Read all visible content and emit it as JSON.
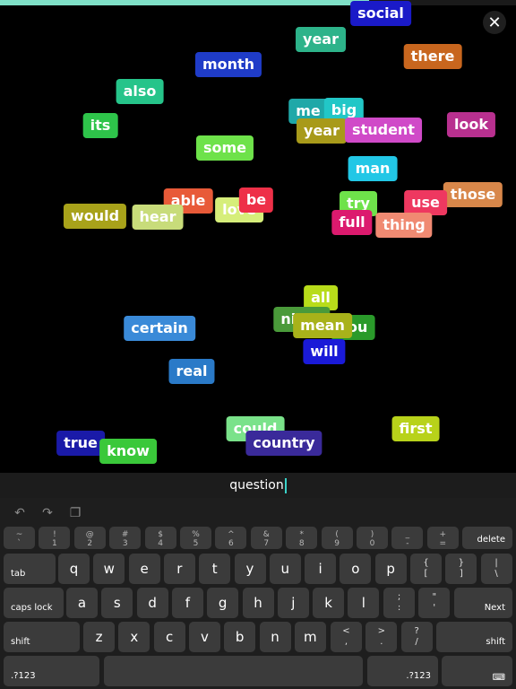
{
  "game": {
    "progress": 0.715,
    "close_symbol": "✕",
    "accent_color": "#7fe0c7",
    "words": [
      {
        "text": "social",
        "color": "#1a1ac8"
      },
      {
        "text": "year",
        "color": "#2db38a"
      },
      {
        "text": "there",
        "color": "#c8661e"
      },
      {
        "text": "month",
        "color": "#1f3cc8"
      },
      {
        "text": "also",
        "color": "#26c48a"
      },
      {
        "text": "me",
        "color": "#1fa8a8"
      },
      {
        "text": "big",
        "color": "#22c7c7"
      },
      {
        "text": "look",
        "color": "#b8308f"
      },
      {
        "text": "its",
        "color": "#2ec44a"
      },
      {
        "text": "year",
        "color": "#a89a1a"
      },
      {
        "text": "student",
        "color": "#d04ac8"
      },
      {
        "text": "some",
        "color": "#6ee24a"
      },
      {
        "text": "man",
        "color": "#22c7e6"
      },
      {
        "text": "those",
        "color": "#d8874a"
      },
      {
        "text": "able",
        "color": "#e85a38"
      },
      {
        "text": "would",
        "color": "#a8a21a"
      },
      {
        "text": "hear",
        "color": "#c8dc7a"
      },
      {
        "text": "love",
        "color": "#d6ee7a"
      },
      {
        "text": "be",
        "color": "#ee3048"
      },
      {
        "text": "try",
        "color": "#6ee24a"
      },
      {
        "text": "full",
        "color": "#dc1a6e"
      },
      {
        "text": "use",
        "color": "#ee3860"
      },
      {
        "text": "thing",
        "color": "#f08a72"
      },
      {
        "text": "all",
        "color": "#b8dc1a"
      },
      {
        "text": "night",
        "color": "#4a9a3a"
      },
      {
        "text": "you",
        "color": "#2a9a2a"
      },
      {
        "text": "mean",
        "color": "#a8b21a"
      },
      {
        "text": "certain",
        "color": "#3a8ad8"
      },
      {
        "text": "will",
        "color": "#1a1ad8"
      },
      {
        "text": "real",
        "color": "#2a7ac8"
      },
      {
        "text": "first",
        "color": "#b8d21a"
      },
      {
        "text": "could",
        "color": "#7ae28a"
      },
      {
        "text": "true",
        "color": "#1a1aa8"
      },
      {
        "text": "country",
        "color": "#3a2a9a"
      },
      {
        "text": "know",
        "color": "#3ac83a"
      }
    ]
  },
  "input": {
    "typed": "question"
  },
  "keyboard": {
    "toolbar": {
      "undo": "↶",
      "redo": "↷",
      "paste": "❐"
    },
    "row1": [
      {
        "alt": "~",
        "main": "`"
      },
      {
        "alt": "!",
        "main": "1"
      },
      {
        "alt": "@",
        "main": "2"
      },
      {
        "alt": "#",
        "main": "3"
      },
      {
        "alt": "$",
        "main": "4"
      },
      {
        "alt": "%",
        "main": "5"
      },
      {
        "alt": "^",
        "main": "6"
      },
      {
        "alt": "&",
        "main": "7"
      },
      {
        "alt": "*",
        "main": "8"
      },
      {
        "alt": "(",
        "main": "9"
      },
      {
        "alt": ")",
        "main": "0"
      },
      {
        "alt": "_",
        "main": "-"
      },
      {
        "alt": "+",
        "main": "="
      }
    ],
    "delete": "delete",
    "tab": "tab",
    "row2": [
      "q",
      "w",
      "e",
      "r",
      "t",
      "y",
      "u",
      "i",
      "o",
      "p"
    ],
    "row2_punct": [
      {
        "alt": "{",
        "main": "["
      },
      {
        "alt": "}",
        "main": "]"
      },
      {
        "alt": "|",
        "main": "\\"
      }
    ],
    "caps": "caps lock",
    "row3": [
      "a",
      "s",
      "d",
      "f",
      "g",
      "h",
      "j",
      "k",
      "l"
    ],
    "row3_punct": [
      {
        "alt": ";",
        "main": ":"
      },
      {
        "alt": "\"",
        "main": "'"
      }
    ],
    "next": "Next",
    "shift": "shift",
    "row4": [
      "z",
      "x",
      "c",
      "v",
      "b",
      "n",
      "m"
    ],
    "row4_punct": [
      {
        "alt": "<",
        "main": ","
      },
      {
        "alt": ">",
        "main": "."
      },
      {
        "alt": "?",
        "main": "/"
      }
    ],
    "numbers": ".?123",
    "keyboard_icon": "⌨"
  }
}
